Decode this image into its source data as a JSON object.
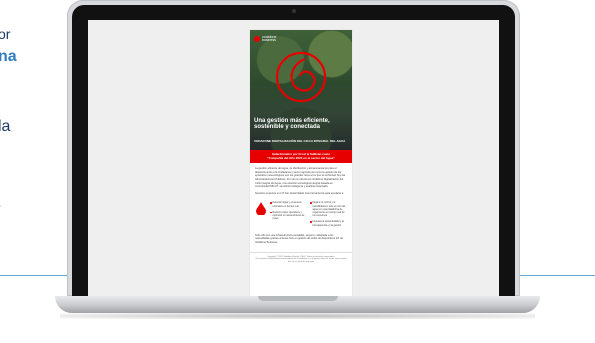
{
  "left_fragments": {
    "line1": "or",
    "line2": "na",
    "line3": "la",
    "line4": "."
  },
  "email": {
    "brand": {
      "name": "vodafone",
      "sub": "business"
    },
    "hero": {
      "title": "Una gestión más eficiente, sostenible y conectada",
      "subtitle": "VODAFONE DIGITALIZACIÓN DEL CICLO INTEGRAL DEL AGUA"
    },
    "award": {
      "line1": "Galardonados por Frost & Sullivan como",
      "line2": "\"Compañía del Año 2024 en el sector del Agua\""
    },
    "intro": "La gestión eficiente del agua, su distribución y almacenamiento para el abastecimiento a la ciudadanía y sector agrícola así como la gestión de los episodios meteorológicos son los grandes retos a los que se enfrentan hoy las Administraciones Públicas. Por eso te ofrecemos Vodafone Digitalización del Ciclo Integral del Agua, una solución tecnológica integral basada en conectividad NB-IoT, sensórica inteligente y analítica avanzada.",
    "help_line": "Nuestros expertos en IoT han desarrollado esta herramienta para ayudarte a:",
    "bullets_left": [
      "Detectar fugas y consumos anómalos en tiempo real",
      "Reducir costes operativos y optimizar el mantenimiento de redes"
    ],
    "bullets_right": [
      "Mejorar el control y la trazabilidad en todo el ciclo del agua con una plataforma de seguimiento en tiempo real de los consumos",
      "Impulsar la sostenibilidad y la transparencia en la gestión"
    ],
    "closing": "Todo ello con una infraestructura escalable, segura y adaptada a los necesidades gracias al know-how en gestión de redes de dispositivos IoT de Vodafone Business.",
    "footer_copyright": "Copyright © 2025 Vodafone España, S.A.U. Todos los derechos reservados.",
    "footer_unsub": "Si no deseas recibir información de productos de vodafone o si lo quieres dejar de recibir estos emails, haz clic en darte de baja aquí"
  },
  "colors": {
    "brand_red": "#e60000",
    "text_navy": "#1d3a66",
    "accent_blue": "#2f7ec2",
    "rule_blue": "#5ea7db"
  }
}
